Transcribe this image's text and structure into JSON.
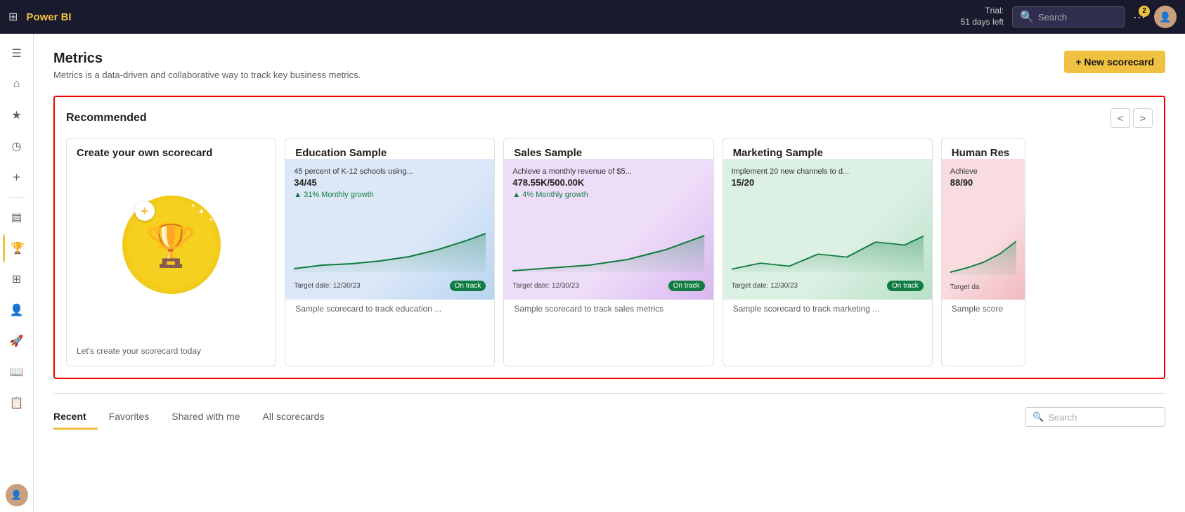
{
  "topbar": {
    "logo": "Power BI",
    "trial_line1": "Trial:",
    "trial_line2": "51 days left",
    "search_placeholder": "Search",
    "badge_count": "2"
  },
  "sidebar": {
    "items": [
      {
        "id": "menu",
        "icon": "☰",
        "label": "Menu"
      },
      {
        "id": "home",
        "icon": "⌂",
        "label": "Home"
      },
      {
        "id": "favorites",
        "icon": "★",
        "label": "Favorites"
      },
      {
        "id": "recent",
        "icon": "◷",
        "label": "Recent"
      },
      {
        "id": "create",
        "icon": "+",
        "label": "Create"
      },
      {
        "id": "data",
        "icon": "▤",
        "label": "Data"
      },
      {
        "id": "metrics",
        "icon": "🏆",
        "label": "Metrics",
        "active": true
      },
      {
        "id": "workspaces",
        "icon": "⊞",
        "label": "Workspaces"
      },
      {
        "id": "people",
        "icon": "👤",
        "label": "People"
      },
      {
        "id": "deploy",
        "icon": "🚀",
        "label": "Deploy"
      },
      {
        "id": "learn",
        "icon": "📖",
        "label": "Learn"
      },
      {
        "id": "reports",
        "icon": "📋",
        "label": "Reports"
      }
    ]
  },
  "page": {
    "title": "Metrics",
    "subtitle": "Metrics is a data-driven and collaborative way to track key business metrics.",
    "new_scorecard_label": "+ New scorecard"
  },
  "recommended": {
    "title": "Recommended",
    "nav_prev": "<",
    "nav_next": ">",
    "cards": [
      {
        "id": "create-own",
        "type": "create",
        "title": "Create your own scorecard",
        "desc": "Let's create your scorecard today"
      },
      {
        "id": "education",
        "type": "sample",
        "title": "Education Sample",
        "bg": "blue-bg",
        "metric_label": "45 percent of K-12 schools using...",
        "metric_value": "34/45",
        "growth": "31% Monthly growth",
        "target_date": "Target date: 12/30/23",
        "status": "On track",
        "desc": "Sample scorecard to track education ..."
      },
      {
        "id": "sales",
        "type": "sample",
        "title": "Sales Sample",
        "bg": "purple-bg",
        "metric_label": "Achieve a monthly revenue of $5...",
        "metric_value": "478.55K/500.00K",
        "growth": "4% Monthly growth",
        "target_date": "Target date: 12/30/23",
        "status": "On track",
        "desc": "Sample scorecard to track sales metrics"
      },
      {
        "id": "marketing",
        "type": "sample",
        "title": "Marketing Sample",
        "bg": "green-bg",
        "metric_label": "Implement 20 new channels to d...",
        "metric_value": "15/20",
        "growth": "",
        "target_date": "Target date: 12/30/23",
        "status": "On track",
        "desc": "Sample scorecard to track marketing ..."
      },
      {
        "id": "human-resources",
        "type": "sample",
        "title": "Human Res",
        "bg": "pink-bg",
        "metric_label": "Achieve",
        "metric_value": "88/90",
        "growth": "",
        "target_date": "Target da",
        "status": "",
        "desc": "Sample score"
      }
    ]
  },
  "tabs": {
    "items": [
      {
        "id": "recent",
        "label": "Recent",
        "active": true
      },
      {
        "id": "favorites",
        "label": "Favorites",
        "active": false
      },
      {
        "id": "shared",
        "label": "Shared with me",
        "active": false
      },
      {
        "id": "all",
        "label": "All scorecards",
        "active": false
      }
    ],
    "search_placeholder": "Search"
  }
}
